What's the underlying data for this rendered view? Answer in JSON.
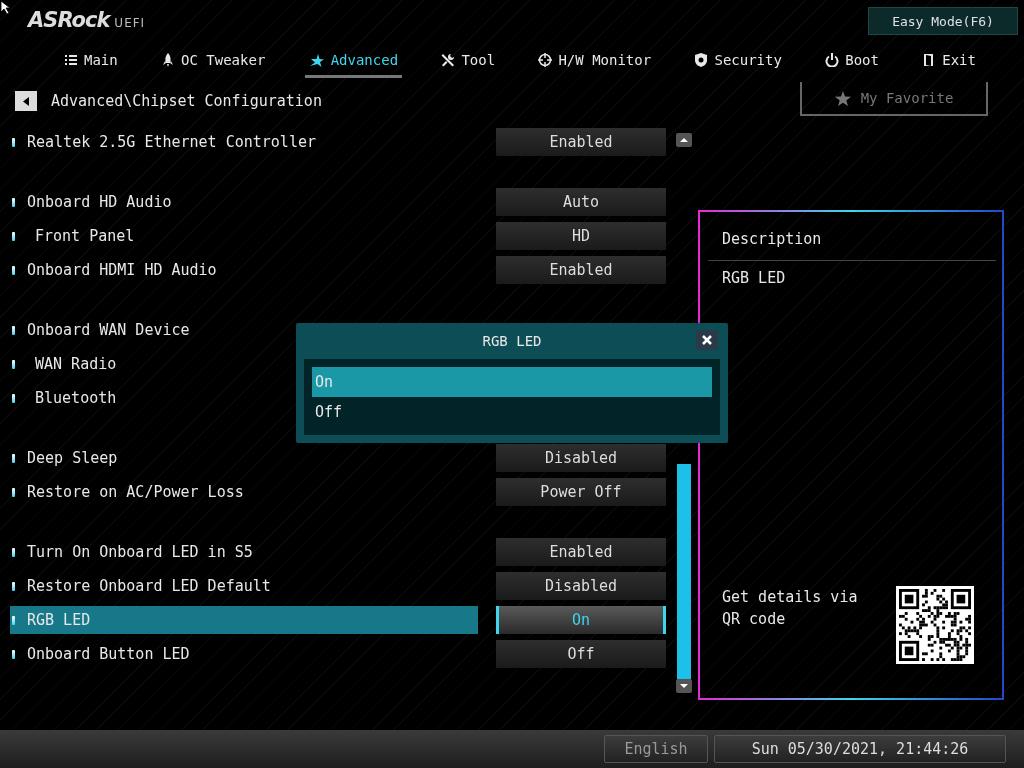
{
  "logo": {
    "brand": "ASRock",
    "suffix": "UEFI"
  },
  "easy_mode_button": "Easy Mode(F6)",
  "tabs": [
    {
      "label": "Main",
      "selected": false
    },
    {
      "label": "OC Tweaker",
      "selected": false
    },
    {
      "label": "Advanced",
      "selected": true
    },
    {
      "label": "Tool",
      "selected": false
    },
    {
      "label": "H/W Monitor",
      "selected": false
    },
    {
      "label": "Security",
      "selected": false
    },
    {
      "label": "Boot",
      "selected": false
    },
    {
      "label": "Exit",
      "selected": false
    }
  ],
  "breadcrumb": "Advanced\\Chipset Configuration",
  "favorite_button": "My Favorite",
  "setting_groups": [
    {
      "items": [
        {
          "label": "Realtek 2.5G Ethernet Controller",
          "value": "Enabled",
          "selected": false
        }
      ]
    },
    {
      "items": [
        {
          "label": "Onboard HD Audio",
          "value": "Auto",
          "selected": false,
          "children": [
            {
              "label": "Front Panel",
              "value": "HD",
              "selected": false
            }
          ]
        },
        {
          "label": "Onboard HDMI HD Audio",
          "value": "Enabled",
          "selected": false
        }
      ]
    },
    {
      "items": [
        {
          "label": "Onboard WAN Device",
          "selected": false,
          "children": [
            {
              "label": "WAN Radio",
              "selected": false
            },
            {
              "label": "Bluetooth",
              "selected": false
            }
          ]
        }
      ]
    },
    {
      "items": [
        {
          "label": "Deep Sleep",
          "value": "Disabled",
          "selected": false
        },
        {
          "label": "Restore on AC/Power Loss",
          "value": "Power Off",
          "selected": false
        }
      ]
    },
    {
      "items": [
        {
          "label": "Turn On Onboard LED in S5",
          "value": "Enabled",
          "selected": false
        },
        {
          "label": "Restore Onboard LED Default",
          "value": "Disabled",
          "selected": false
        },
        {
          "label": "RGB LED",
          "value": "On",
          "selected": true
        },
        {
          "label": "Onboard Button LED",
          "value": "Off",
          "selected": false
        }
      ]
    }
  ],
  "description": {
    "title": "Description",
    "text": "RGB LED",
    "qr_text": "Get details via QR code"
  },
  "dialog": {
    "title": "RGB LED",
    "options": [
      {
        "label": "On",
        "selected": true
      },
      {
        "label": "Off",
        "selected": false
      }
    ]
  },
  "status_bar": {
    "language": "English",
    "datetime": "Sun 05/30/2021, 21:44:26"
  }
}
